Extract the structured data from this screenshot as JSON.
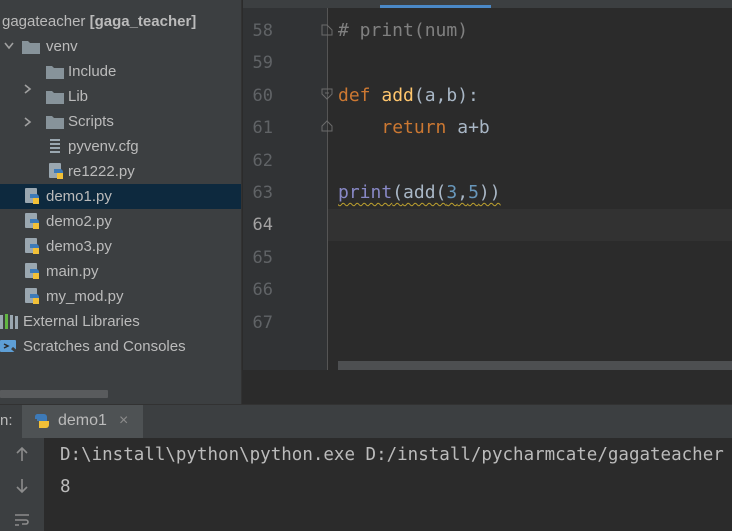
{
  "project": {
    "root_name": "gagateacher",
    "root_module": "[gaga_teacher]",
    "items": [
      {
        "label": "venv",
        "type": "folder"
      },
      {
        "label": "Include",
        "type": "folder"
      },
      {
        "label": "Lib",
        "type": "folder"
      },
      {
        "label": "Scripts",
        "type": "folder"
      },
      {
        "label": "pyvenv.cfg",
        "type": "cfg"
      },
      {
        "label": "re1222.py",
        "type": "python"
      },
      {
        "label": "demo1.py",
        "type": "python",
        "selected": true
      },
      {
        "label": "demo2.py",
        "type": "python"
      },
      {
        "label": "demo3.py",
        "type": "python"
      },
      {
        "label": "main.py",
        "type": "python"
      },
      {
        "label": "my_mod.py",
        "type": "python"
      },
      {
        "label": "External Libraries",
        "type": "libraries"
      },
      {
        "label": "Scratches and Consoles",
        "type": "scratches"
      }
    ]
  },
  "editor": {
    "line_numbers": [
      "58",
      "59",
      "60",
      "61",
      "62",
      "63",
      "64",
      "65",
      "66",
      "67"
    ],
    "current_line": "64",
    "code": {
      "l58": "# print(num)",
      "l60_kw": "def",
      "l60_fn": "add",
      "l60_params": "(a,b):",
      "l61_kw": "return",
      "l61_expr": "a+b",
      "l63_print": "print",
      "l63_open": "(",
      "l63_add": "add(",
      "l63_n1": "3",
      "l63_comma": ",",
      "l63_n2": "5",
      "l63_close": "))"
    }
  },
  "run": {
    "label": "n:",
    "tab_label": "demo1",
    "close_glyph": "×",
    "output": [
      "D:\\install\\python\\python.exe D:/install/pycharmcate/gagateacher",
      "8"
    ]
  },
  "colors": {
    "keyword": "#cc7832",
    "function": "#ffc66d",
    "builtin": "#8888c6",
    "number": "#6897bb",
    "comment": "#808080",
    "selection": "#0d293e"
  },
  "icons": {
    "folder": "folder-icon",
    "python": "python-file-icon",
    "cfg": "config-file-icon",
    "libraries": "libraries-icon",
    "scratches": "scratches-icon"
  }
}
